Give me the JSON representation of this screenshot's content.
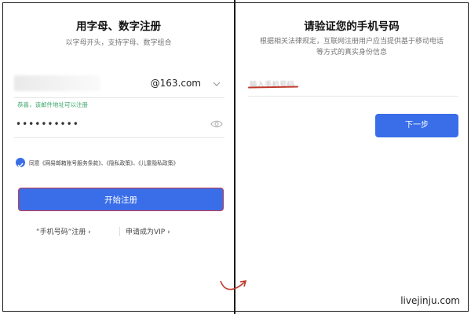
{
  "left": {
    "title": "用字母、数字注册",
    "subtitle": "以字母开头，支持字母、数字组合",
    "email": {
      "domain": "@163.com"
    },
    "hint": "恭喜，该邮件地址可以注册",
    "password": {
      "value": "••••••••••"
    },
    "agreement": "同意《网易邮箱账号服务条款》、《隐私政策》、《儿童隐私政策》",
    "register_button": "开始注册",
    "phone_register_link": "“手机号码”注册  ›",
    "vip_link": "申请成为VIP  ›"
  },
  "right": {
    "title": "请验证您的手机号码",
    "subtitle_line1": "根据相关法律规定，互联网注册用户应当提供基于移动电话",
    "subtitle_line2": "等方式的真实身份信息",
    "phone_placeholder": "输入手机号码",
    "next_button": "下一步"
  },
  "watermark": "livejinju.com",
  "colors": {
    "primary": "#3a6ee8",
    "success": "#3ba56a",
    "highlight": "#c73a4a"
  }
}
